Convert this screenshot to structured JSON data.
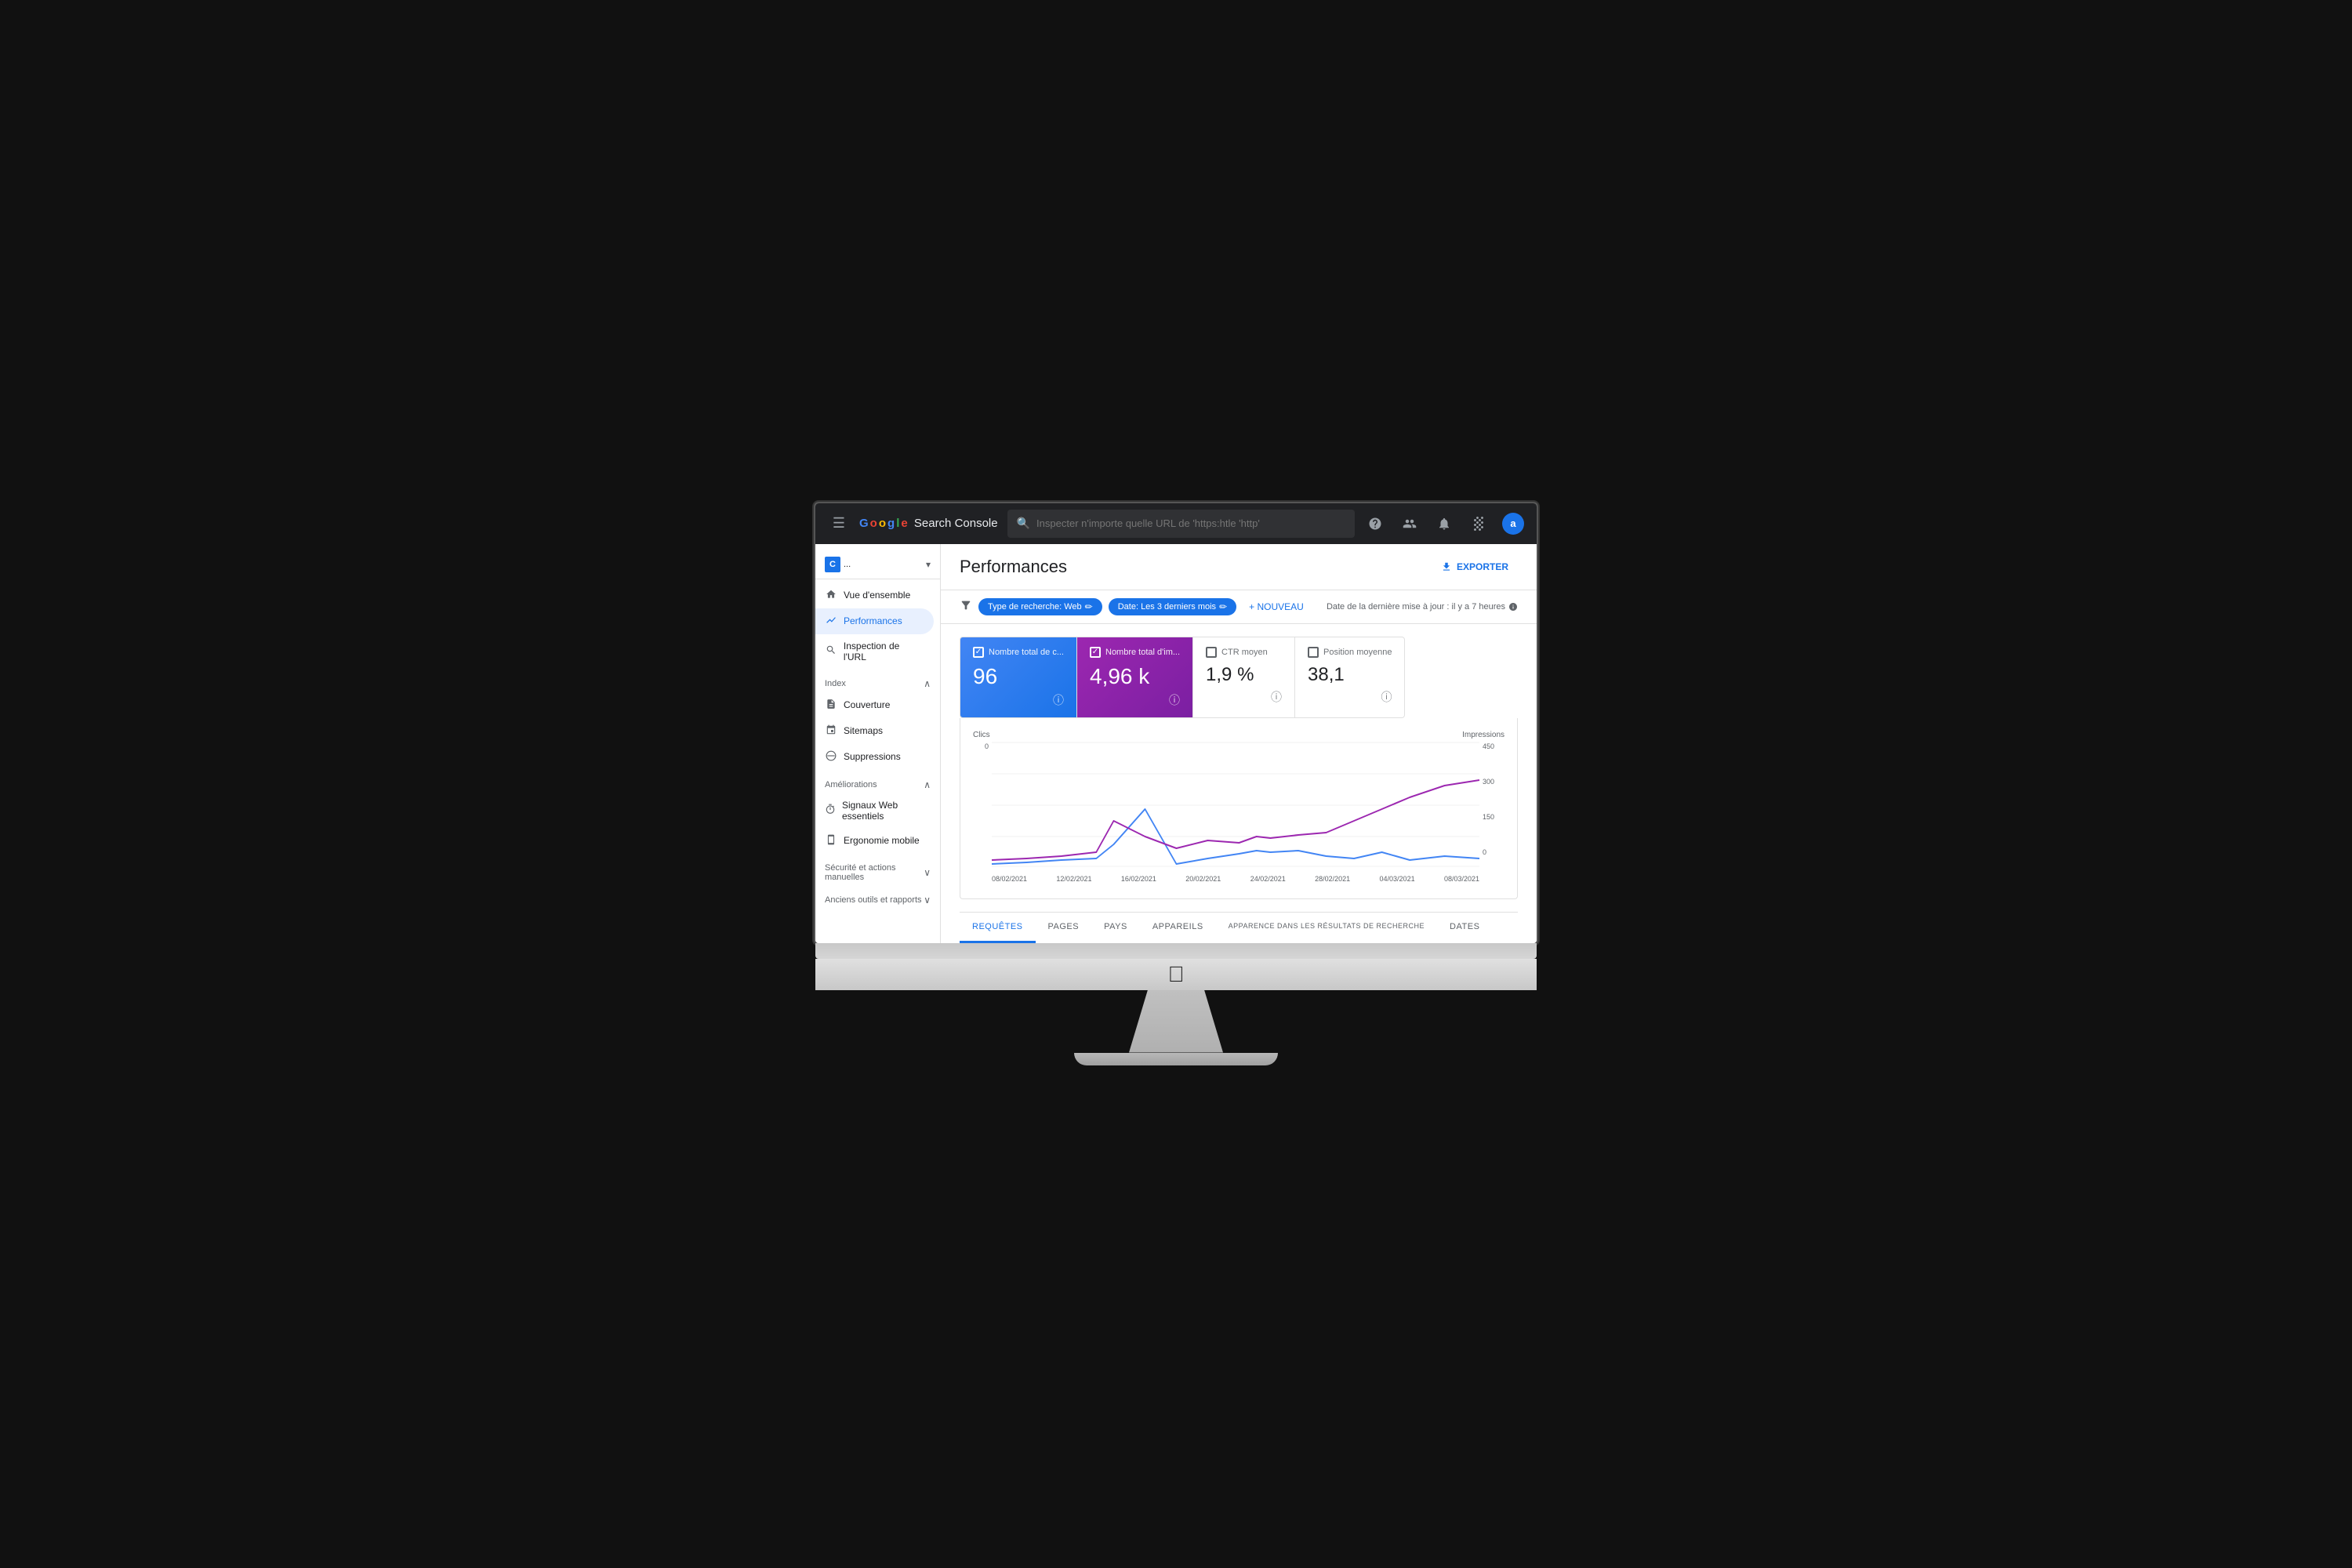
{
  "topbar": {
    "logo": "Google Search Console",
    "search_placeholder": "Inspecter n'importe quelle URL de 'https:htle 'http'",
    "icons": [
      "help",
      "people",
      "bell",
      "grid",
      "avatar"
    ],
    "avatar_label": "a"
  },
  "sidebar": {
    "property": {
      "icon": "C",
      "name": "...",
      "color": "#1a73e8"
    },
    "items": [
      {
        "label": "Vue d'ensemble",
        "icon": "🏠",
        "active": false
      },
      {
        "label": "Performances",
        "icon": "📈",
        "active": true
      },
      {
        "label": "Inspection de l'URL",
        "icon": "🔍",
        "active": false
      }
    ],
    "sections": [
      {
        "label": "Index",
        "collapsed": false,
        "items": [
          {
            "label": "Couverture",
            "icon": "📄"
          },
          {
            "label": "Sitemaps",
            "icon": "🗺"
          },
          {
            "label": "Suppressions",
            "icon": "🚫"
          }
        ]
      },
      {
        "label": "Améliorations",
        "collapsed": false,
        "items": [
          {
            "label": "Signaux Web essentiels",
            "icon": "⏱"
          },
          {
            "label": "Ergonomie mobile",
            "icon": "📱"
          }
        ]
      },
      {
        "label": "Sécurité et actions manuelles",
        "collapsed": true,
        "items": []
      },
      {
        "label": "Anciens outils et rapports",
        "collapsed": true,
        "items": []
      }
    ]
  },
  "content": {
    "title": "Performances",
    "export_label": "EXPORTER",
    "filters": {
      "icon": "filter",
      "chips": [
        {
          "label": "Type de recherche: Web",
          "editable": true
        },
        {
          "label": "Date: Les 3 derniers mois",
          "editable": true
        }
      ],
      "add_label": "+ NOUVEAU",
      "update_info": "Date de la dernière mise à jour : il y a 7 heures"
    },
    "metrics": [
      {
        "label": "Nombre total de c...",
        "value": "96",
        "type": "active-blue",
        "checked": true
      },
      {
        "label": "Nombre total d'im...",
        "value": "4,96 k",
        "type": "active-purple",
        "checked": true
      },
      {
        "label": "CTR moyen",
        "value": "1,9 %",
        "type": "inactive",
        "checked": false
      },
      {
        "label": "Position moyenne",
        "value": "38,1",
        "type": "inactive",
        "checked": false
      }
    ],
    "chart": {
      "left_label": "Clics",
      "right_label": "Impressions",
      "max_left": "0",
      "max_right": "450",
      "mid_right": "300",
      "low_right": "150",
      "zero": "0",
      "dates": [
        "08/02/2021",
        "12/02/2021",
        "16/02/2021",
        "20/02/2021",
        "24/02/2021",
        "28/02/2021",
        "04/03/2021",
        "08/03/2021"
      ]
    },
    "tabs": [
      {
        "label": "REQUÊTES",
        "active": true
      },
      {
        "label": "PAGES",
        "active": false
      },
      {
        "label": "PAYS",
        "active": false
      },
      {
        "label": "APPAREILS",
        "active": false
      },
      {
        "label": "APPARENCE DANS LES RÉSULTATS DE RECHERCHE",
        "active": false
      },
      {
        "label": "DATES",
        "active": false
      }
    ]
  }
}
